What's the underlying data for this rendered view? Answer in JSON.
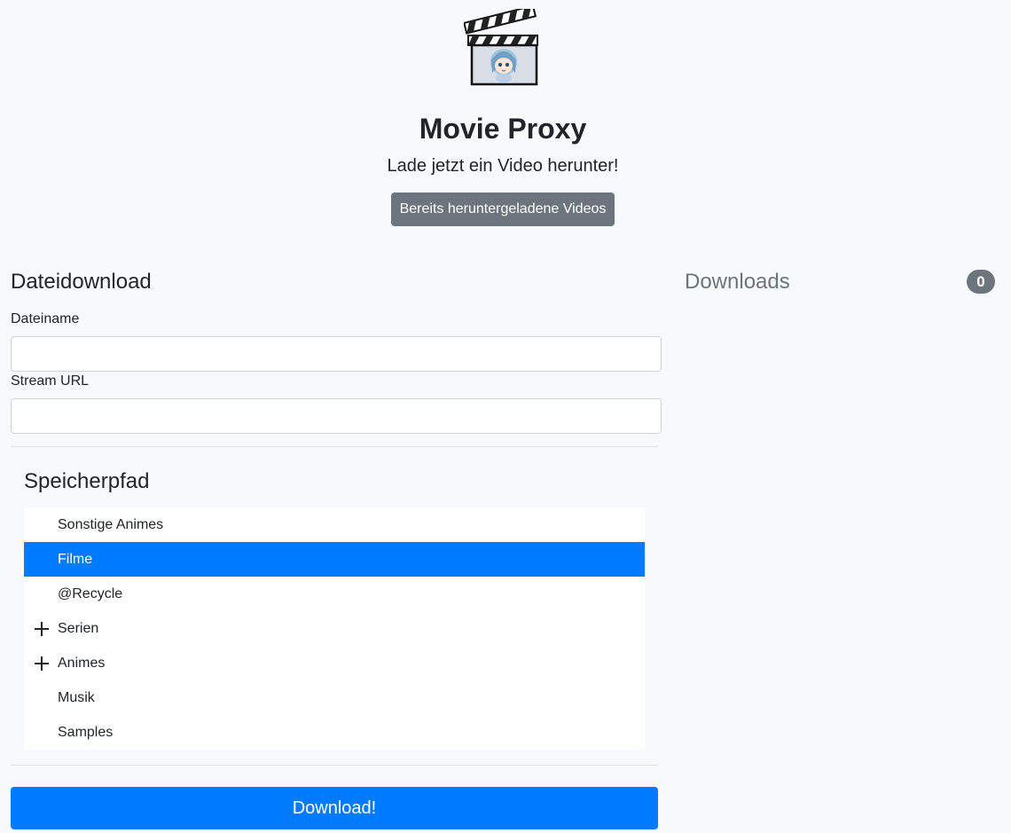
{
  "header": {
    "title": "Movie Proxy",
    "subtitle": "Lade jetzt ein Video herunter!",
    "history_button": "Bereits heruntergeladene Videos"
  },
  "form": {
    "heading": "Dateidownload",
    "filename_label": "Dateiname",
    "filename_value": "",
    "stream_url_label": "Stream URL",
    "stream_url_value": "",
    "path_heading": "Speicherpfad",
    "folders": [
      {
        "label": "Sonstige Animes",
        "expandable": false,
        "selected": false
      },
      {
        "label": "Filme",
        "expandable": false,
        "selected": true
      },
      {
        "label": "@Recycle",
        "expandable": false,
        "selected": false
      },
      {
        "label": "Serien",
        "expandable": true,
        "selected": false
      },
      {
        "label": "Animes",
        "expandable": true,
        "selected": false
      },
      {
        "label": "Musik",
        "expandable": false,
        "selected": false
      },
      {
        "label": "Samples",
        "expandable": false,
        "selected": false
      }
    ],
    "download_button": "Download!"
  },
  "downloads": {
    "heading": "Downloads",
    "count": "0"
  },
  "colors": {
    "primary": "#007bff",
    "secondary": "#6c757d",
    "background": "#f8f9fa"
  },
  "icons": {
    "logo": "clapperboard-anime-logo",
    "expand": "plus-icon"
  }
}
